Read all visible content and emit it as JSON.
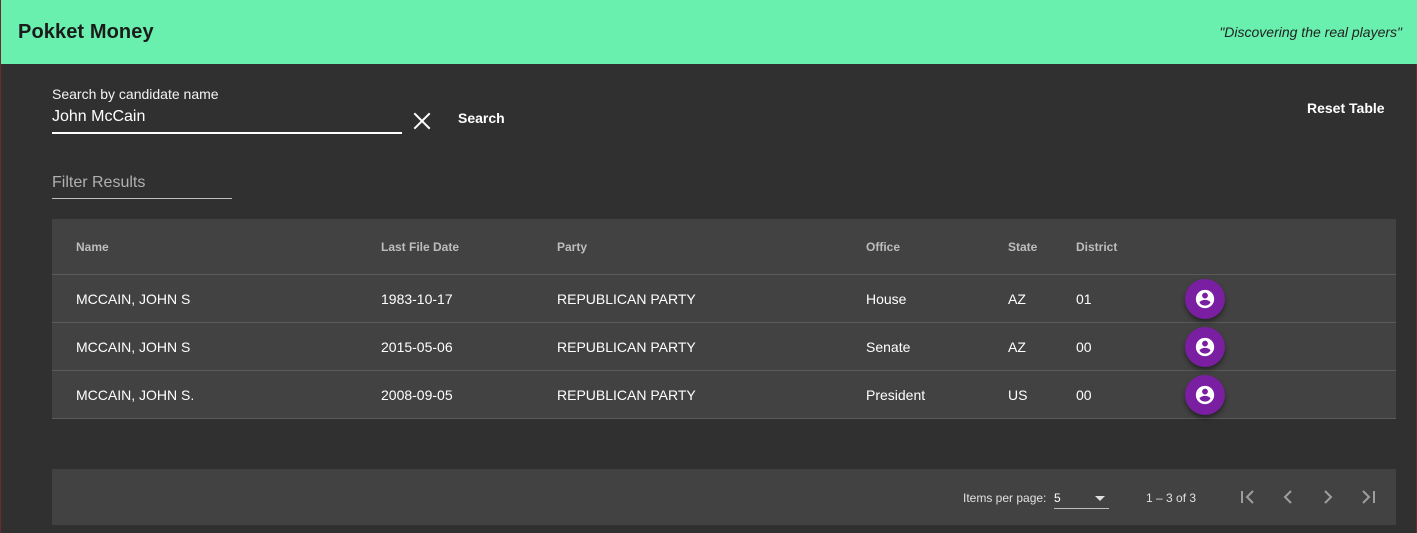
{
  "header": {
    "title": "Pokket Money",
    "tagline": "\"Discovering the real players\"",
    "accent_color": "#69f0ae"
  },
  "search": {
    "label": "Search by candidate name",
    "value": "John McCain",
    "clear_icon": "close-icon",
    "search_label": "Search",
    "reset_label": "Reset Table"
  },
  "filter": {
    "placeholder": "Filter Results",
    "value": ""
  },
  "table": {
    "columns": {
      "name": "Name",
      "date": "Last File Date",
      "party": "Party",
      "office": "Office",
      "state": "State",
      "district": "District"
    },
    "rows": [
      {
        "name": "MCCAIN, JOHN S",
        "date": "1983-10-17",
        "party": "REPUBLICAN PARTY",
        "office": "House",
        "state": "AZ",
        "district": "01",
        "action_icon": "account-circle-icon"
      },
      {
        "name": "MCCAIN, JOHN S",
        "date": "2015-05-06",
        "party": "REPUBLICAN PARTY",
        "office": "Senate",
        "state": "AZ",
        "district": "00",
        "action_icon": "account-circle-icon"
      },
      {
        "name": "MCCAIN, JOHN S.",
        "date": "2008-09-05",
        "party": "REPUBLICAN PARTY",
        "office": "President",
        "state": "US",
        "district": "00",
        "action_icon": "account-circle-icon"
      }
    ],
    "action_color": "#7b1fa2"
  },
  "paginator": {
    "items_per_page_label": "Items per page:",
    "items_per_page_value": "5",
    "range_label": "1 – 3 of 3"
  }
}
